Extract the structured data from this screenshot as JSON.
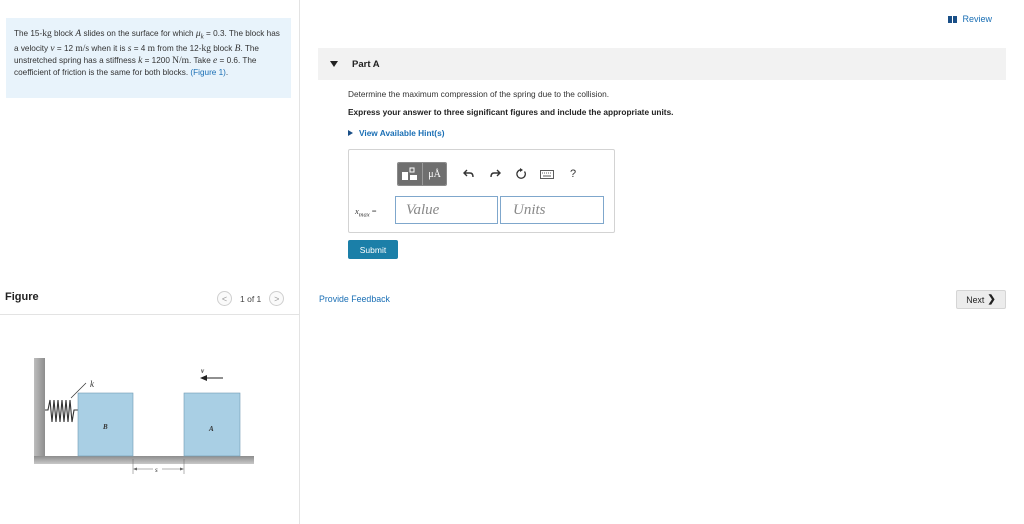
{
  "problem": {
    "t1": "The 15-",
    "kg1": "kg",
    "t2": " block ",
    "A": "A",
    "t3": " slides on the surface for which ",
    "mu": "μ",
    "muSub": "k",
    "t4": " = 0.3. The block has a velocity ",
    "v": "v",
    "t5": " = 12 ",
    "vUnit": "m/s",
    "t6": " when it is ",
    "s": "s",
    "t7": " = 4 ",
    "sUnit": "m",
    "t8": " from the 12-",
    "kg2": "kg",
    "t9": " block ",
    "B": "B",
    "t10": ". The unstretched spring has a stiffness ",
    "k": "k",
    "t11": " = 1200 ",
    "kUnit": "N/m",
    "t12": ". Take ",
    "e": "e",
    "t13": " = 0.6. The coefficient of friction is the same for both blocks. ",
    "figureLink": "(Figure 1)",
    "t14": "."
  },
  "figurePanel": {
    "title": "Figure",
    "pager": "1 of 1",
    "prev": "<",
    "next": ">"
  },
  "figure": {
    "labelK": "k",
    "labelB": "B",
    "labelA": "A",
    "labelV": "v",
    "labelS": "s",
    "blockColor": "#a9cfe4",
    "wallColor": "#9a9a9a"
  },
  "review": {
    "label": "Review"
  },
  "part": {
    "label": "Part A",
    "question": "Determine the maximum compression of the spring due to the collision.",
    "instruction": "Express your answer to three significant figures and include the appropriate units.",
    "hints": "View Available Hint(s)"
  },
  "answer": {
    "variable": "x",
    "variableSub": "max",
    "equals": " =",
    "valuePlaceholder": "Value",
    "unitsPlaceholder": "Units",
    "muA": "μÅ",
    "help": "?"
  },
  "submit": {
    "label": "Submit"
  },
  "feedback": {
    "label": "Provide Feedback"
  },
  "nextBtn": {
    "label": "Next",
    "chev": "❯"
  },
  "colors": {
    "accent": "#1a6fb5",
    "submit": "#1b7fa8",
    "problemBg": "#e8f3fb"
  }
}
